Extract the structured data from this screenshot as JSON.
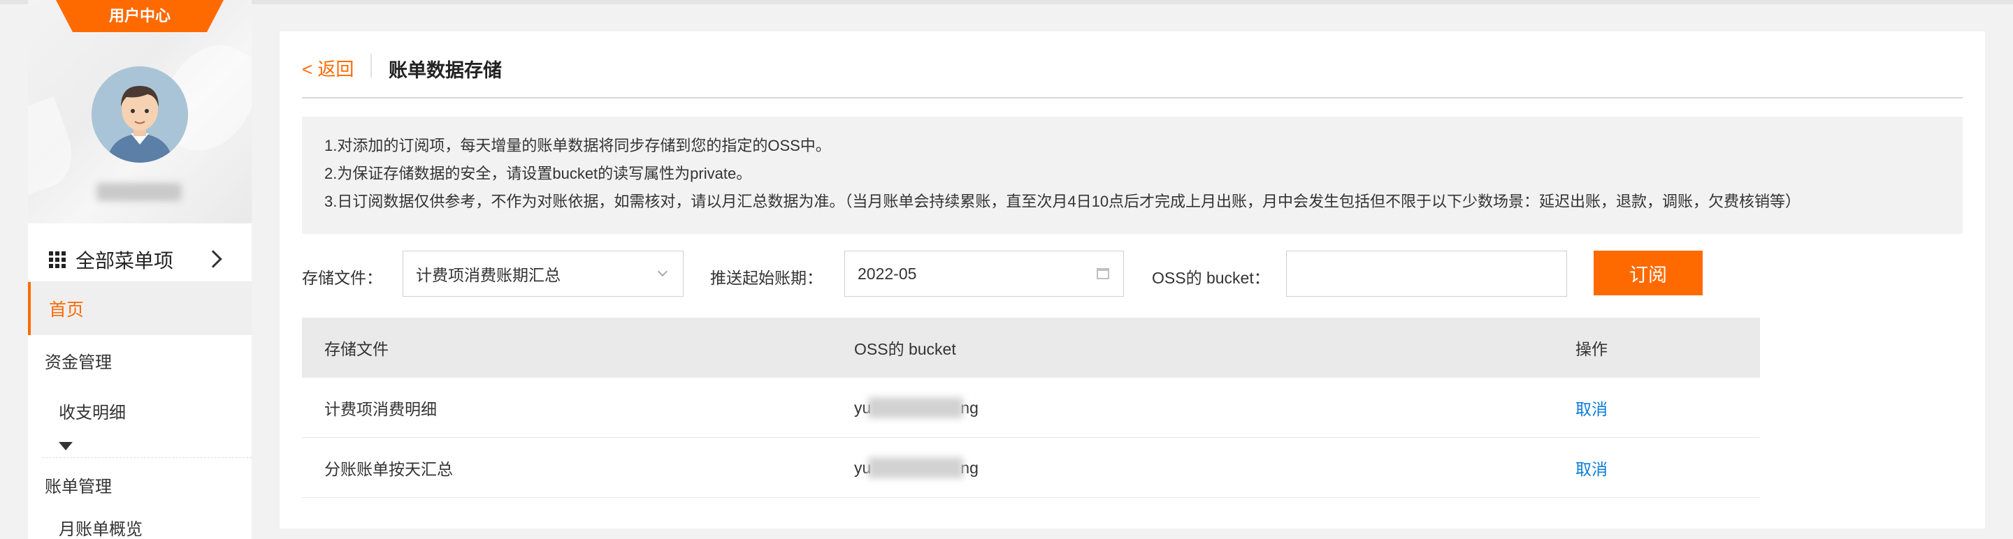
{
  "sidebar": {
    "user_center_tab": "用户中心",
    "all_menu_label": "全部菜单项",
    "items": [
      {
        "label": "首页",
        "active": true
      },
      {
        "label": "资金管理"
      },
      {
        "label": "收支明细"
      },
      {
        "label": "账单管理"
      },
      {
        "label": "月账单概览"
      }
    ]
  },
  "header": {
    "back_label": "< 返回",
    "title": "账单数据存储"
  },
  "notice": {
    "lines": [
      "1.对添加的订阅项，每天增量的账单数据将同步存储到您的指定的OSS中。",
      "2.为保证存储数据的安全，请设置bucket的读写属性为private。",
      "3.日订阅数据仅供参考，不作为对账依据，如需核对，请以月汇总数据为准。（当月账单会持续累账，直至次月4日10点后才完成上月出账，月中会发生包括但不限于以下少数场景：延迟出账，退款，调账，欠费核销等）"
    ]
  },
  "form": {
    "file_label": "存储文件：",
    "file_value": "计费项消费账期汇总",
    "start_label": "推送起始账期：",
    "start_value": "2022-05",
    "bucket_label": "OSS的 bucket：",
    "bucket_value": "",
    "subscribe_label": "订阅"
  },
  "table": {
    "columns": [
      "存储文件",
      "OSS的 bucket",
      "操作"
    ],
    "rows": [
      {
        "file": "计费项消费明细",
        "bucket_prefix": "yu",
        "bucket_suffix": "ng",
        "action": "取消"
      },
      {
        "file": "分账账单按天汇总",
        "bucket_prefix": "yu",
        "bucket_suffix": "ng",
        "action": "取消"
      }
    ]
  },
  "colors": {
    "accent": "#ff6a00",
    "link": "#0a7bd8"
  }
}
